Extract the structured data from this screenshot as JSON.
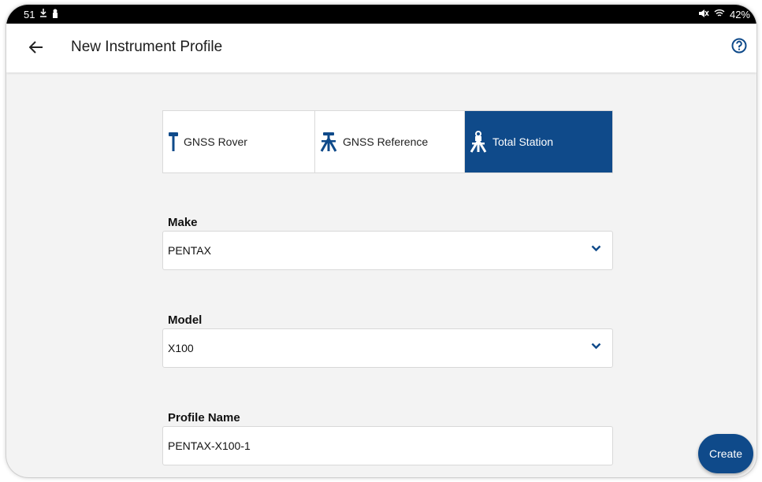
{
  "status_bar": {
    "time": "51",
    "battery": "42%",
    "left_icons": [
      "download-icon",
      "notification-icon"
    ],
    "right_icons": [
      "mute-icon",
      "wifi-icon"
    ]
  },
  "header": {
    "title": "New Instrument Profile",
    "back_icon": "arrow-left-icon",
    "help_icon": "help-circle-icon"
  },
  "instrument_types": [
    {
      "label": "GNSS Rover",
      "icon": "rover-pole-icon",
      "selected": false
    },
    {
      "label": "GNSS Reference",
      "icon": "tripod-icon",
      "selected": false
    },
    {
      "label": "Total Station",
      "icon": "total-station-icon",
      "selected": true
    }
  ],
  "form": {
    "make": {
      "label": "Make",
      "value": "PENTAX"
    },
    "model": {
      "label": "Model",
      "value": "X100"
    },
    "profile_name": {
      "label": "Profile Name",
      "value": "PENTAX-X100-1"
    }
  },
  "actions": {
    "create_label": "Create"
  },
  "colors": {
    "accent": "#0f4a8a",
    "icon_blue": "#0f4a8a"
  }
}
